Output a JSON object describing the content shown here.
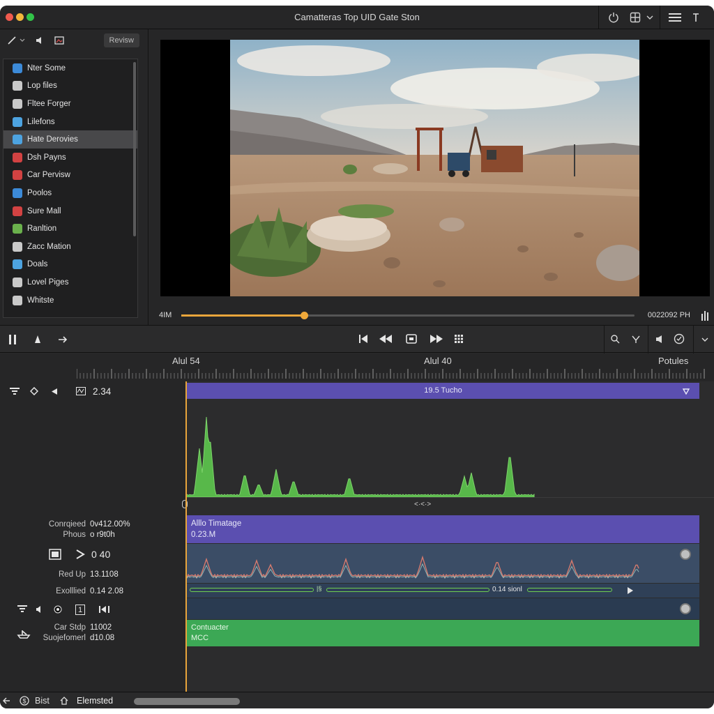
{
  "window": {
    "title": "Camatteras Top UID Gate Ston",
    "traffic_colors": [
      "#f05a4e",
      "#f3b73b",
      "#32c449"
    ]
  },
  "titlebar_icons": [
    "power-icon",
    "layout-icon",
    "chevron-down-icon",
    "hamburger-icon",
    "cursor-icon"
  ],
  "left_panel": {
    "toolbar": {
      "revise_label": "Revisw"
    },
    "items": [
      {
        "label": "Nter Some",
        "icon": "user-icon",
        "color": "#3c8ad8"
      },
      {
        "label": "Lop files",
        "icon": "folder-icon",
        "color": "#c9c9c9"
      },
      {
        "label": "Fltee Forger",
        "icon": "file-icon",
        "color": "#c9c9c9"
      },
      {
        "label": "Lilefons",
        "icon": "globe-icon",
        "color": "#4da3e0"
      },
      {
        "label": "Hate Derovies",
        "icon": "media-icon",
        "color": "#4da3e0"
      },
      {
        "label": "Dsh Payns",
        "icon": "app-icon",
        "color": "#d24242"
      },
      {
        "label": "Car Pervisw",
        "icon": "car-icon",
        "color": "#d24242"
      },
      {
        "label": "Poolos",
        "icon": "photos-icon",
        "color": "#3c8ad8"
      },
      {
        "label": "Sure Mall",
        "icon": "mail-icon",
        "color": "#d24242"
      },
      {
        "label": "Ranltion",
        "icon": "circle-icon",
        "color": "#6ab04c"
      },
      {
        "label": "Zacc Mation",
        "icon": "motion-icon",
        "color": "#c9c9c9"
      },
      {
        "label": "Doals",
        "icon": "deals-icon",
        "color": "#4da3e0"
      },
      {
        "label": "Lovel Piges",
        "icon": "pages-icon",
        "color": "#c9c9c9"
      },
      {
        "label": "Whitste",
        "icon": "whistle-icon",
        "color": "#c9c9c9"
      }
    ],
    "selected_index": 4
  },
  "viewer": {
    "time_left": "4IM",
    "time_right": "0022092 PH",
    "progress": 0.27
  },
  "ruler": {
    "label_left": "Alul 54",
    "label_mid": "Alul 40",
    "label_right": "Potules"
  },
  "timeline_left": {
    "top_value": "2.34",
    "rows": [
      {
        "label": "Conrqieed",
        "value": "0v412.00%"
      },
      {
        "label": "Phous",
        "value": "o r9t0h"
      },
      {
        "label": "Red Up",
        "value": "13.1108"
      },
      {
        "label": "Exolllied",
        "value": "0.14 2.08"
      },
      {
        "label": "Car Stdp",
        "value": "11002"
      },
      {
        "label": "Suojefomerl",
        "value": "d10.08"
      }
    ],
    "play_value": "0 40",
    "frame_value": "1"
  },
  "tracks": {
    "title_clip": "19.5 Tucho",
    "clip2_title": "Alllo Timatage",
    "clip2_sub": "0.23.M",
    "green_bar_label": "0.14 sionl",
    "conductor_title": "Contuacter",
    "conductor_sub": "MCC"
  },
  "statusbar": {
    "left_label": "Bist",
    "right_label": "Elemsted"
  }
}
